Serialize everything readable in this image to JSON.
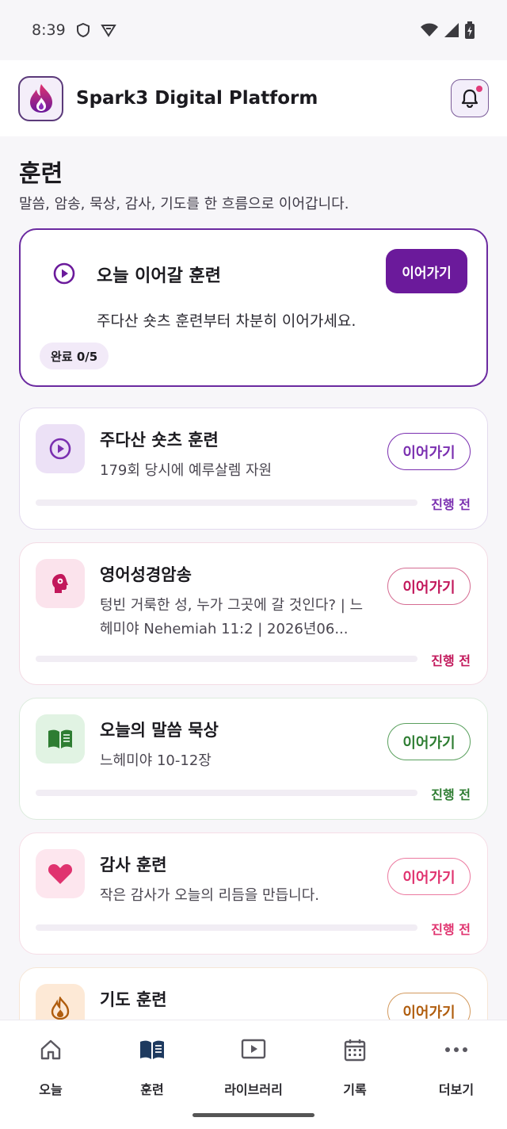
{
  "status_bar": {
    "time": "8:39"
  },
  "header": {
    "app_title": "Spark3 Digital Platform"
  },
  "page": {
    "title": "훈련",
    "subtitle": "말씀, 암송, 묵상, 감사, 기도를 한 흐름으로 이어갑니다."
  },
  "today": {
    "title": "오늘 이어갈 훈련",
    "button": "이어가기",
    "description": "주다산 숏츠 훈련부터 차분히 이어가세요.",
    "badge": "완료 0/5"
  },
  "trainings": [
    {
      "title": "주다산 숏츠 훈련",
      "desc": "179회 당시에 예루살렘 자원",
      "button": "이어가기",
      "status": "진행 전",
      "accent": "#7a2fb0",
      "icon_bg": "#ece1f6",
      "progress": 0
    },
    {
      "title": "영어성경암송",
      "desc": "텅빈 거룩한 성, 누가 그곳에 갈 것인다? | 느헤미야 Nehemiah 11:2 | 2026년06...",
      "button": "이어가기",
      "status": "진행 전",
      "accent": "#c2185b",
      "icon_bg": "#fbe3ec",
      "progress": 0
    },
    {
      "title": "오늘의 말씀 묵상",
      "desc": "느헤미야 10-12장",
      "button": "이어가기",
      "status": "진행 전",
      "accent": "#2e7d32",
      "icon_bg": "#e1f3e3",
      "progress": 0
    },
    {
      "title": "감사 훈련",
      "desc": "작은 감사가 오늘의 리듬을 만듭니다.",
      "button": "이어가기",
      "status": "진행 전",
      "accent": "#e0336f",
      "icon_bg": "#fde6ee",
      "progress": 0
    },
    {
      "title": "기도 훈련",
      "desc": "",
      "button": "이어가기",
      "status": "",
      "accent": "#b05d0e",
      "icon_bg": "#fde9d6",
      "progress": 0
    }
  ],
  "nav": [
    {
      "label": "오늘",
      "icon": "home-icon"
    },
    {
      "label": "훈련",
      "icon": "book-open-icon"
    },
    {
      "label": "라이브러리",
      "icon": "play-box-icon"
    },
    {
      "label": "기록",
      "icon": "calendar-icon"
    },
    {
      "label": "더보기",
      "icon": "more-horizontal-icon"
    }
  ],
  "colors": {
    "brand": "#6b1a9b",
    "active_nav": "#1e3a5f"
  }
}
